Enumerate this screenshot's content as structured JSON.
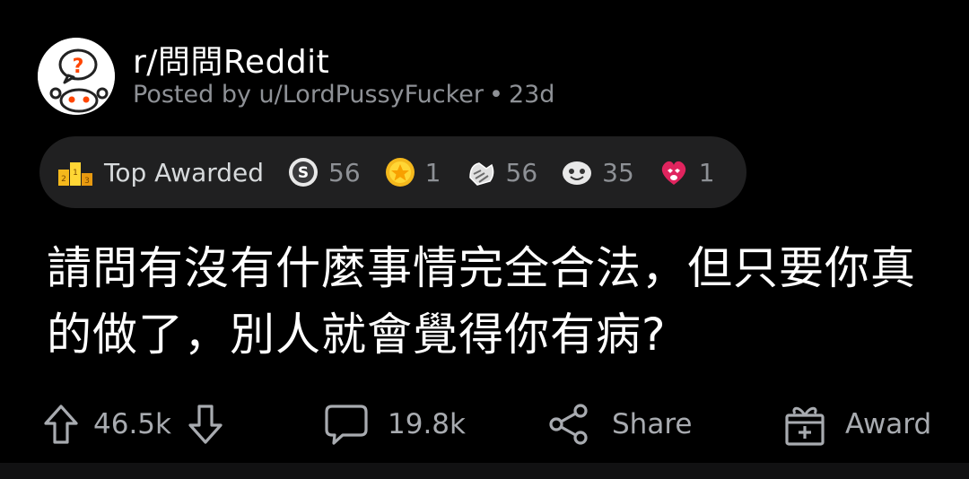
{
  "post": {
    "subreddit": "r/問問Reddit",
    "posted_by": "Posted by u/LordPussyFucker",
    "age": "23d",
    "title": "請問有沒有什麼事情完全合法，但只要你真的做了，別人就會覺得你有病?"
  },
  "awards": {
    "label": "Top Awarded",
    "items": [
      {
        "icon": "silver-award-icon",
        "count": "56"
      },
      {
        "icon": "gold-award-icon",
        "count": "1"
      },
      {
        "icon": "wholesome-hug-award-icon",
        "count": "56"
      },
      {
        "icon": "helpful-award-icon",
        "count": "35"
      },
      {
        "icon": "heart-eyes-award-icon",
        "count": "1"
      }
    ]
  },
  "actions": {
    "upvotes": "46.5k",
    "comments": "19.8k",
    "share": "Share",
    "award": "Award"
  },
  "colors": {
    "background": "#000000",
    "pill": "#202021",
    "text_primary": "#ffffff",
    "text_secondary": "#8e9196",
    "gold": "#f4b81c"
  }
}
